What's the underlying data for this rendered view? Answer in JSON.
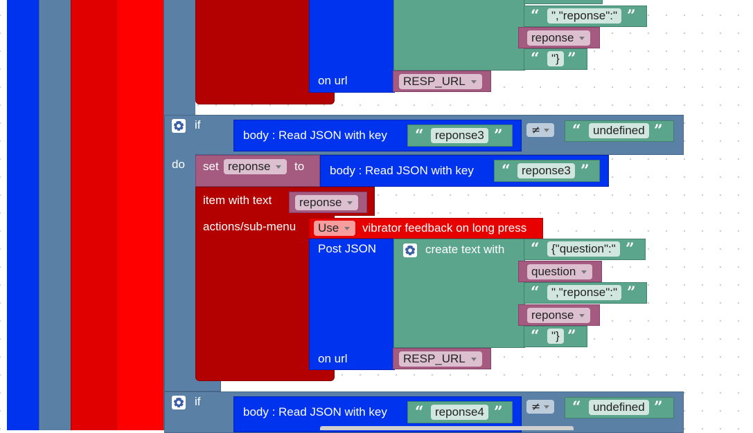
{
  "colors": {
    "blue": "#0033ee",
    "green": "#5ba58c",
    "maroon": "#b30000",
    "red": "#e60000",
    "variable": "#a55b80",
    "slate": "#5b80a5"
  },
  "top": {
    "reponse_key_text": "\",\"reponse\":\"",
    "reponse_var": "reponse",
    "close_brace": "\"}",
    "on_url": "on url",
    "url_var": "RESP_URL"
  },
  "if1": {
    "if_label": "if",
    "read_json": "body : Read JSON with key",
    "key": "reponse3",
    "operator": "≠",
    "compare": "undefined",
    "do_label": "do",
    "set_label": "set",
    "set_var": "reponse",
    "to_label": "to",
    "read_json2": "body : Read JSON with key",
    "key2": "reponse3",
    "item_with_text": "item with text",
    "item_var": "reponse",
    "actions_label": "actions/sub-menu",
    "use_option": "Use",
    "vibrator_text": "vibrator feedback on long press",
    "post_json": "Post JSON",
    "create_text": "create text with",
    "t1": "{\"question\":\"",
    "v1": "question",
    "t2": "\",\"reponse\":\"",
    "v2": "reponse",
    "t3": "\"}",
    "on_url": "on url",
    "url_var": "RESP_URL"
  },
  "if2": {
    "if_label": "if",
    "read_json": "body : Read JSON with key",
    "key": "reponse4",
    "operator": "≠",
    "compare": "undefined"
  },
  "icons": [
    "gear-icon",
    "quote-open-icon",
    "quote-close-icon",
    "dropdown-arrow-icon"
  ]
}
